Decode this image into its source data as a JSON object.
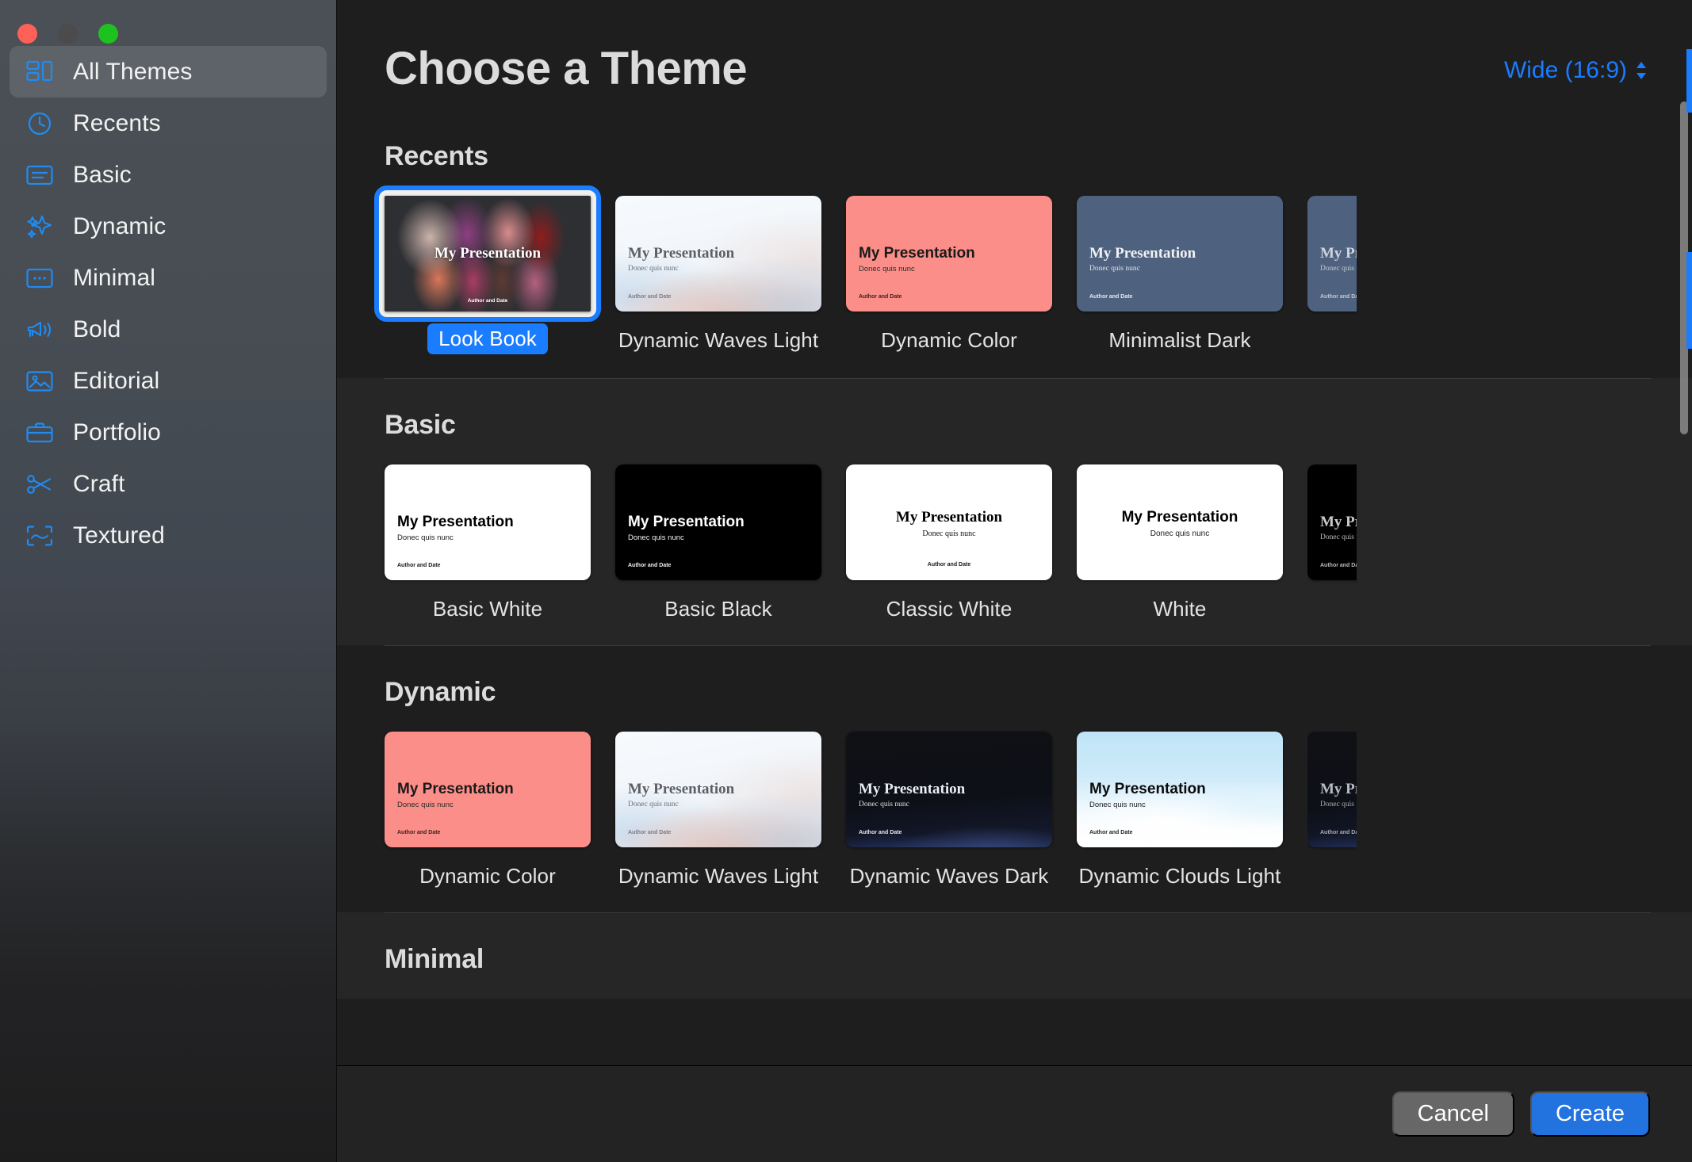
{
  "window": {
    "traffic_lights": [
      "close",
      "minimize",
      "zoom"
    ]
  },
  "sidebar": {
    "items": [
      {
        "label": "All Themes",
        "icon": "grid-layout-icon",
        "active": true
      },
      {
        "label": "Recents",
        "icon": "clock-icon",
        "active": false
      },
      {
        "label": "Basic",
        "icon": "basic-slide-icon",
        "active": false
      },
      {
        "label": "Dynamic",
        "icon": "sparkles-icon",
        "active": false
      },
      {
        "label": "Minimal",
        "icon": "minimal-dots-icon",
        "active": false
      },
      {
        "label": "Bold",
        "icon": "megaphone-icon",
        "active": false
      },
      {
        "label": "Editorial",
        "icon": "photo-icon",
        "active": false
      },
      {
        "label": "Portfolio",
        "icon": "briefcase-icon",
        "active": false
      },
      {
        "label": "Craft",
        "icon": "scissors-icon",
        "active": false
      },
      {
        "label": "Textured",
        "icon": "texture-frame-icon",
        "active": false
      }
    ]
  },
  "header": {
    "title": "Choose a Theme",
    "aspect_ratio": "Wide (16:9)"
  },
  "slide_text": {
    "title": "My Presentation",
    "subtitle": "Donec quis nunc",
    "author": "Author and Date"
  },
  "sections": [
    {
      "id": "recents",
      "title": "Recents",
      "themes": [
        {
          "name": "Look Book",
          "style": "bg-lookbook",
          "layout": "lay-lookbook",
          "selected": true,
          "title_color": "#ffffff",
          "sub_color": "#ffffff",
          "auth_color": "#ffffff",
          "has_sub": false,
          "has_auth": true,
          "serif": true
        },
        {
          "name": "Dynamic Waves Light",
          "style": "bg-waveslight",
          "layout": "lay-left",
          "selected": false,
          "title_color": "#5c6066",
          "sub_color": "#6b7077",
          "auth_color": "#797e86",
          "has_sub": true,
          "has_auth": true,
          "serif": true
        },
        {
          "name": "Dynamic Color",
          "style": "bg-coral",
          "layout": "lay-left",
          "selected": false,
          "title_color": "#1a1a1a",
          "sub_color": "#2b2b2b",
          "auth_color": "#3a2522",
          "has_sub": true,
          "has_auth": true,
          "serif": false
        },
        {
          "name": "Minimalist Dark",
          "style": "bg-slate",
          "layout": "lay-left",
          "selected": false,
          "title_color": "#f0f2f5",
          "sub_color": "#dfe3e9",
          "auth_color": "#e4e8ee",
          "has_sub": true,
          "has_auth": true,
          "serif": true
        }
      ],
      "peek": {
        "style": "bg-slate",
        "layout": "lay-left",
        "title_color": "#cfd4db",
        "sub_color": "#c3c8d0",
        "auth_color": "#c3c8d0"
      }
    },
    {
      "id": "basic",
      "title": "Basic",
      "themes": [
        {
          "name": "Basic White",
          "style": "bg-white",
          "layout": "lay-left",
          "selected": false,
          "title_color": "#000000",
          "sub_color": "#1a1a1a",
          "auth_color": "#1a1a1a",
          "has_sub": true,
          "has_auth": true,
          "serif": false
        },
        {
          "name": "Basic Black",
          "style": "bg-black",
          "layout": "lay-left",
          "selected": false,
          "title_color": "#ffffff",
          "sub_color": "#f0f0f0",
          "auth_color": "#f0f0f0",
          "has_sub": true,
          "has_auth": true,
          "serif": false
        },
        {
          "name": "Classic White",
          "style": "bg-white",
          "layout": "lay-center",
          "selected": false,
          "title_color": "#000000",
          "sub_color": "#111111",
          "auth_color": "#1a1a1a",
          "has_sub": true,
          "has_auth": true,
          "serif": true
        },
        {
          "name": "White",
          "style": "bg-white",
          "layout": "lay-center",
          "selected": false,
          "title_color": "#000000",
          "sub_color": "#1a1a1a",
          "auth_color": "#1a1a1a",
          "has_sub": true,
          "has_auth": false,
          "serif": false
        }
      ],
      "peek": {
        "style": "bg-black",
        "layout": "lay-left",
        "title_color": "#cccccc",
        "sub_color": "#bbbbbb",
        "auth_color": "#bbbbbb"
      }
    },
    {
      "id": "dynamic",
      "title": "Dynamic",
      "themes": [
        {
          "name": "Dynamic Color",
          "style": "bg-coral",
          "layout": "lay-left",
          "selected": false,
          "title_color": "#1a1a1a",
          "sub_color": "#2b2b2b",
          "auth_color": "#3a2522",
          "has_sub": true,
          "has_auth": true,
          "serif": false
        },
        {
          "name": "Dynamic Waves Light",
          "style": "bg-waveslight",
          "layout": "lay-left",
          "selected": false,
          "title_color": "#5c6066",
          "sub_color": "#6b7077",
          "auth_color": "#797e86",
          "has_sub": true,
          "has_auth": true,
          "serif": true
        },
        {
          "name": "Dynamic Waves Dark",
          "style": "bg-wavesdark",
          "layout": "lay-left",
          "selected": false,
          "title_color": "#eceef3",
          "sub_color": "#dde0e8",
          "auth_color": "#e3e6ee",
          "has_sub": true,
          "has_auth": true,
          "serif": true
        },
        {
          "name": "Dynamic Clouds Light",
          "style": "bg-cloudslight",
          "layout": "lay-left",
          "selected": false,
          "title_color": "#0b0b0b",
          "sub_color": "#1a1a1a",
          "auth_color": "#23282c",
          "has_sub": true,
          "has_auth": true,
          "serif": false
        }
      ],
      "peek": {
        "style": "bg-wavesdark",
        "layout": "lay-left",
        "title_color": "#b9bcc4",
        "sub_color": "#a9acb4",
        "auth_color": "#a9acb4"
      }
    },
    {
      "id": "minimal",
      "title": "Minimal",
      "themes": [],
      "peek": null
    }
  ],
  "footer": {
    "cancel_label": "Cancel",
    "create_label": "Create"
  },
  "colors": {
    "accent": "#1a7cff",
    "create_button": "#2272e0",
    "cancel_button": "#676767",
    "window_bg": "#1e1e1e",
    "section_alt_bg": "#262626"
  }
}
